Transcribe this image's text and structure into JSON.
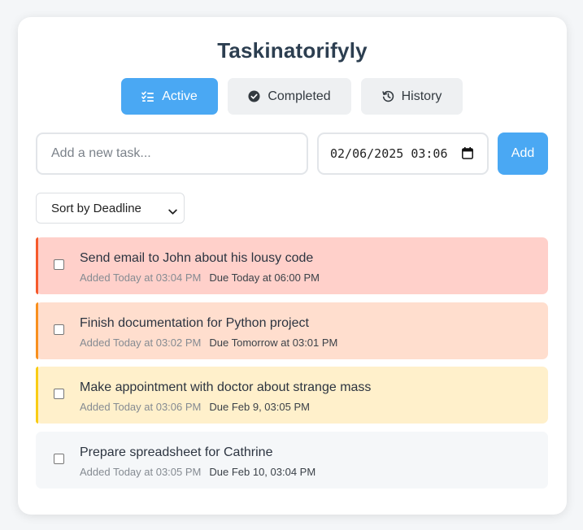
{
  "app": {
    "title": "Taskinatorifyly"
  },
  "tabs": [
    {
      "label": "Active",
      "icon": "checklist-icon",
      "active": true
    },
    {
      "label": "Completed",
      "icon": "check-circle-icon",
      "active": false
    },
    {
      "label": "History",
      "icon": "history-icon",
      "active": false
    }
  ],
  "new_task": {
    "placeholder": "Add a new task...",
    "value": "",
    "deadline_value": "02/06/2025 03:06",
    "add_label": "Add"
  },
  "sort": {
    "selected": "Sort by Deadline"
  },
  "tasks": [
    {
      "title": "Send email to John about his lousy code",
      "added": "Added Today at 03:04 PM",
      "due": "Due Today at 06:00 PM",
      "checked": false,
      "urgency_color": "#f55a2c",
      "bg_color": "#ffd0ca"
    },
    {
      "title": "Finish documentation for Python project",
      "added": "Added Today at 03:02 PM",
      "due": "Due Tomorrow at 03:01 PM",
      "checked": false,
      "urgency_color": "#f8901e",
      "bg_color": "#ffdece"
    },
    {
      "title": "Make appointment with doctor about strange mass",
      "added": "Added Today at 03:06 PM",
      "due": "Due Feb 9, 03:05 PM",
      "checked": false,
      "urgency_color": "#f9cc14",
      "bg_color": "#fff0cb"
    },
    {
      "title": "Prepare spreadsheet for Cathrine",
      "added": "Added Today at 03:05 PM",
      "due": "Due Feb 10, 03:04 PM",
      "checked": false,
      "urgency_color": "#f5f7f9",
      "bg_color": "#f5f7f9"
    }
  ],
  "colors": {
    "accent": "#4aa8f3",
    "title": "#2c3e50"
  }
}
